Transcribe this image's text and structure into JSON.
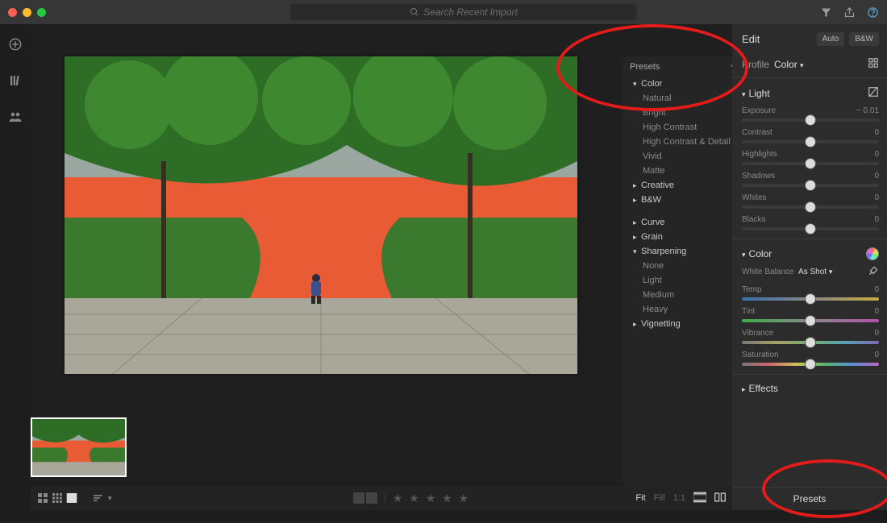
{
  "search": {
    "placeholder": "Search Recent Import"
  },
  "presets": {
    "title": "Presets",
    "groups": {
      "color": {
        "label": "Color",
        "items": [
          "Natural",
          "Bright",
          "High Contrast",
          "High Contrast & Detail",
          "Vivid",
          "Matte"
        ]
      },
      "creative": {
        "label": "Creative"
      },
      "bw": {
        "label": "B&W"
      },
      "curve": {
        "label": "Curve"
      },
      "grain": {
        "label": "Grain"
      },
      "sharpening": {
        "label": "Sharpening",
        "items": [
          "None",
          "Light",
          "Medium",
          "Heavy"
        ]
      },
      "vignetting": {
        "label": "Vignetting"
      }
    }
  },
  "edit": {
    "title": "Edit",
    "auto": "Auto",
    "bw": "B&W",
    "profile_label": "Profile",
    "profile_value": "Color",
    "light": {
      "label": "Light",
      "sliders": {
        "exposure": {
          "label": "Exposure",
          "value": "− 0.01",
          "pos": 50
        },
        "contrast": {
          "label": "Contrast",
          "value": "0",
          "pos": 50
        },
        "highlights": {
          "label": "Highlights",
          "value": "0",
          "pos": 50
        },
        "shadows": {
          "label": "Shadows",
          "value": "0",
          "pos": 50
        },
        "whites": {
          "label": "Whites",
          "value": "0",
          "pos": 50
        },
        "blacks": {
          "label": "Blacks",
          "value": "0",
          "pos": 50
        }
      }
    },
    "color": {
      "label": "Color",
      "wb_label": "White Balance",
      "wb_value": "As Shot",
      "sliders": {
        "temp": {
          "label": "Temp",
          "value": "0",
          "pos": 50
        },
        "tint": {
          "label": "Tint",
          "value": "0",
          "pos": 50
        },
        "vibrance": {
          "label": "Vibrance",
          "value": "0",
          "pos": 50
        },
        "saturation": {
          "label": "Saturation",
          "value": "0",
          "pos": 50
        }
      }
    },
    "effects": {
      "label": "Effects"
    },
    "presets_button": "Presets"
  },
  "bottombar": {
    "fit": "Fit",
    "fill": "Fill",
    "oneone": "1:1"
  }
}
